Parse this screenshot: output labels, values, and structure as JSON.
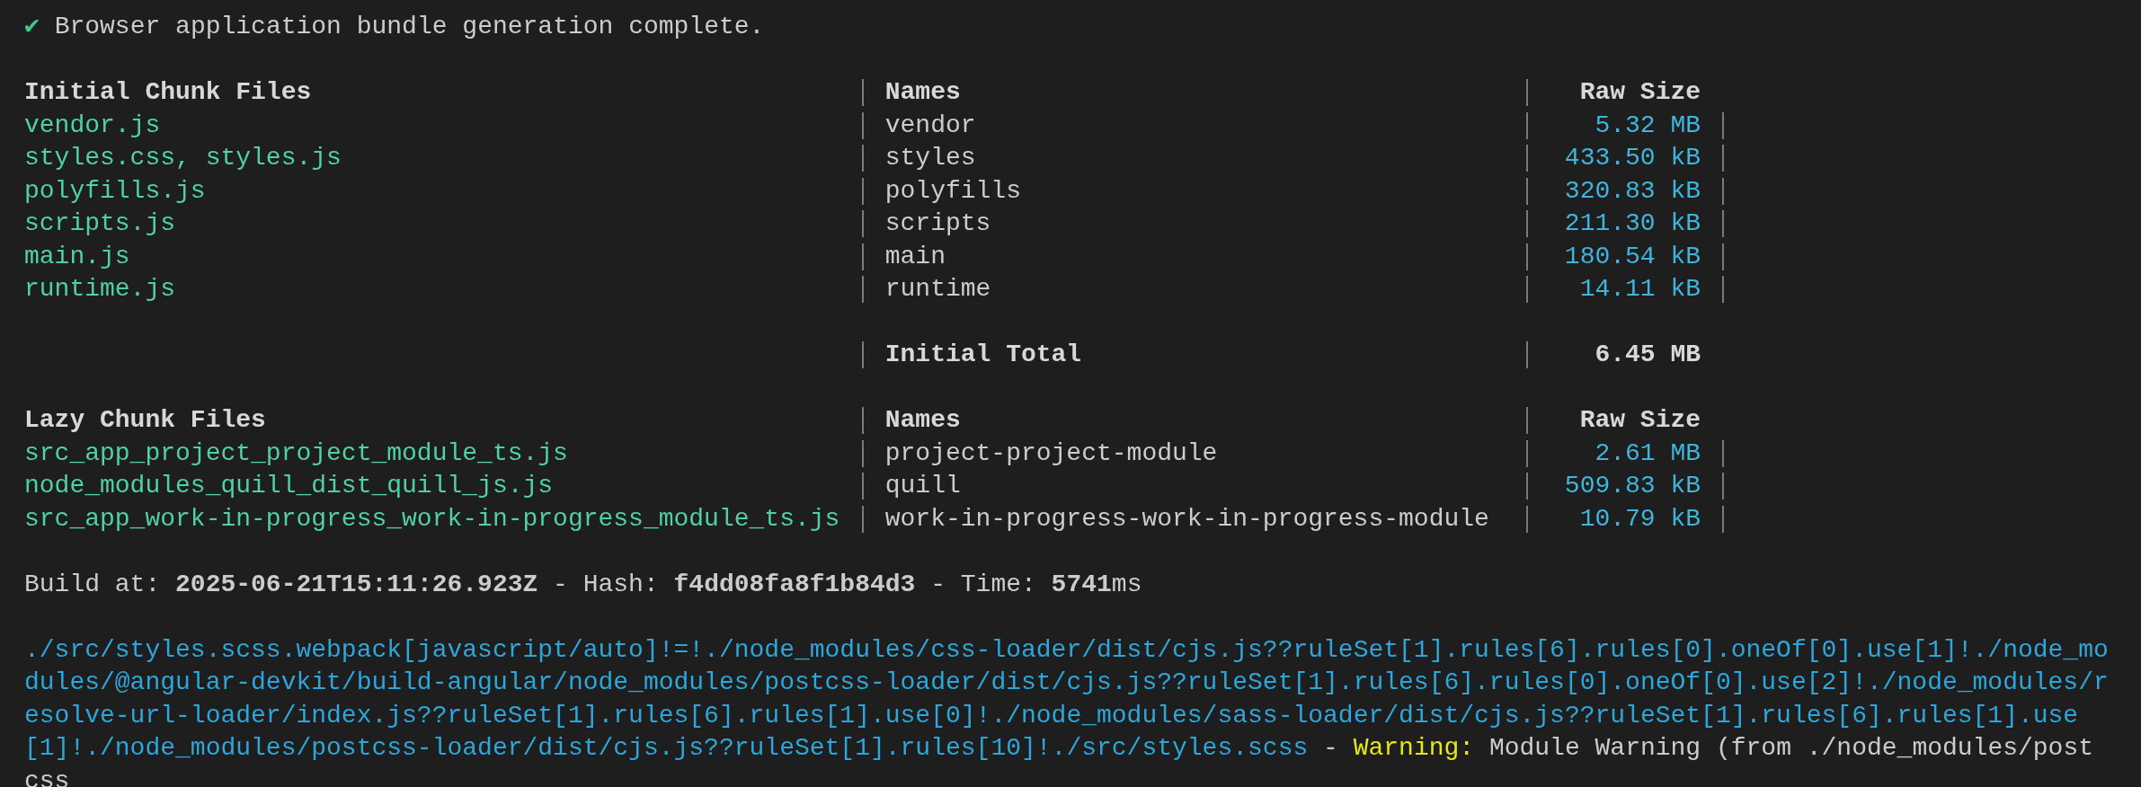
{
  "status": {
    "icon": "✔",
    "text": "Browser application bundle generation complete."
  },
  "tables": [
    {
      "rows": [
        {
          "kind": "header",
          "file": "Initial Chunk Files",
          "name": "Names",
          "size": "Raw Size"
        },
        {
          "kind": "file",
          "file": "vendor.js",
          "name": "vendor",
          "size": "5.32 MB"
        },
        {
          "kind": "file",
          "file": "styles.css, styles.js",
          "name": "styles",
          "size": "433.50 kB"
        },
        {
          "kind": "file",
          "file": "polyfills.js",
          "name": "polyfills",
          "size": "320.83 kB"
        },
        {
          "kind": "file",
          "file": "scripts.js",
          "name": "scripts",
          "size": "211.30 kB"
        },
        {
          "kind": "file",
          "file": "main.js",
          "name": "main",
          "size": "180.54 kB"
        },
        {
          "kind": "file",
          "file": "runtime.js",
          "name": "runtime",
          "size": "14.11 kB"
        }
      ]
    },
    {
      "rows": [
        {
          "kind": "total",
          "name": "Initial Total",
          "size": "6.45 MB"
        }
      ]
    },
    {
      "rows": [
        {
          "kind": "header",
          "file": "Lazy Chunk Files",
          "name": "Names",
          "size": "Raw Size"
        },
        {
          "kind": "file",
          "file": "src_app_project_project_module_ts.js",
          "name": "project-project-module",
          "size": "2.61 MB"
        },
        {
          "kind": "file",
          "file": "node_modules_quill_dist_quill_js.js",
          "name": "quill",
          "size": "509.83 kB"
        },
        {
          "kind": "file",
          "file": "src_app_work-in-progress_work-in-progress_module_ts.js",
          "name": "work-in-progress-work-in-progress-module",
          "size": "10.79 kB"
        }
      ]
    }
  ],
  "build": "Build at: **2025-06-21T15:11:26.923Z** - Hash: **f4dd08fa8f1b84d3** - Time: **5741**ms",
  "warning": {
    "source": "./src/styles.scss.webpack[javascript/auto]!=!./node_modules/css-loader/dist/cjs.js??ruleSet[1].rules[6].rules[0].oneOf[0].use[1]!./node_modules/@angular-devkit/build-angular/node_modules/postcss-loader/dist/cjs.js??ruleSet[1].rules[6].rules[0].oneOf[0].use[2]!./node_modules/resolve-url-loader/index.js??ruleSet[1].rules[6].rules[1].use[0]!./node_modules/sass-loader/dist/cjs.js??ruleSet[1].rules[6].rules[1].use[1]!./node_modules/postcss-loader/dist/cjs.js??ruleSet[1].rules[10]!./src/styles.scss",
    "separator": "-",
    "label": "Warning:",
    "message": "Module Warning (from ./node_modules/postcss"
  }
}
